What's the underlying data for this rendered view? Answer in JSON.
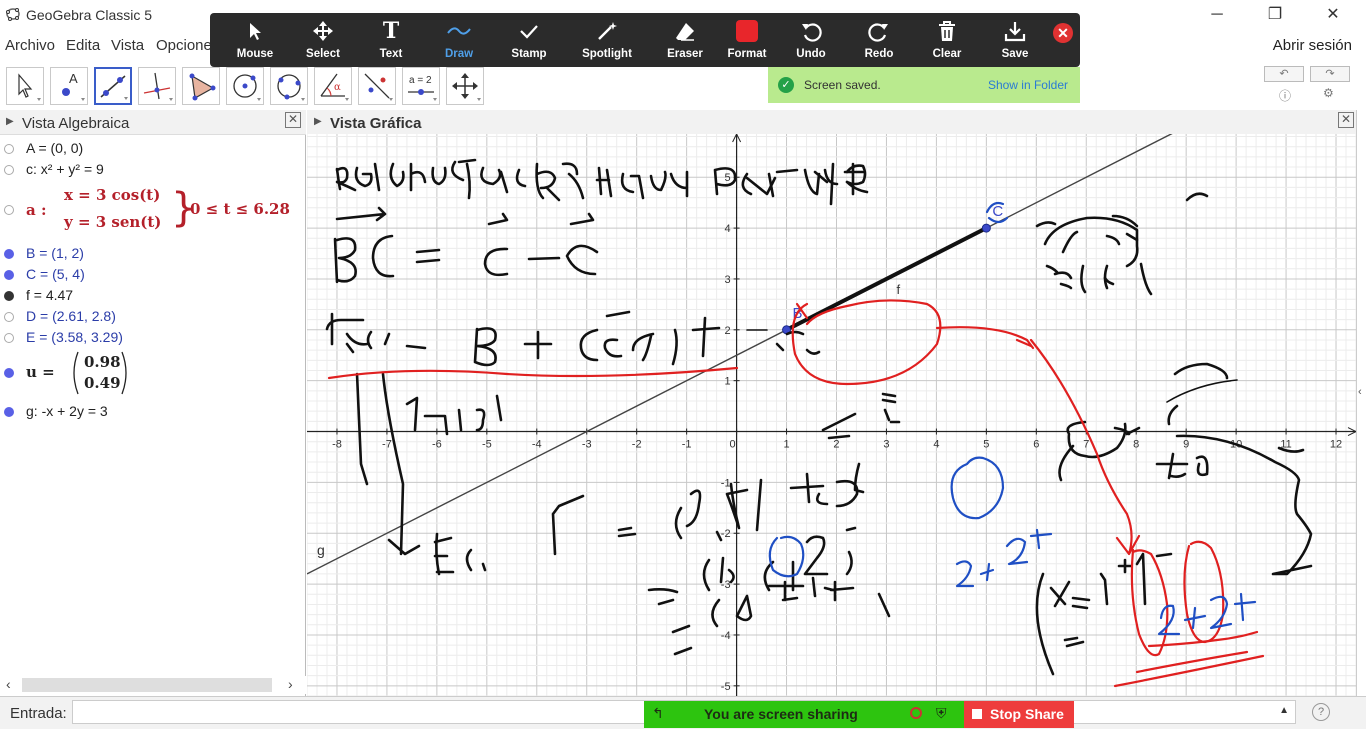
{
  "window": {
    "title": "GeoGebra Classic 5"
  },
  "menu": {
    "items": [
      "Archivo",
      "Edita",
      "Vista",
      "Opcione"
    ],
    "login": "Abrir sesión"
  },
  "overlay_toolbar": {
    "buttons": [
      {
        "label": "Mouse",
        "icon": "cursor-icon"
      },
      {
        "label": "Select",
        "icon": "move-icon"
      },
      {
        "label": "Text",
        "icon": "text-icon"
      },
      {
        "label": "Draw",
        "icon": "draw-wave-icon",
        "active": true
      },
      {
        "label": "Stamp",
        "icon": "checkmark-icon"
      },
      {
        "label": "Spotlight",
        "icon": "wand-icon"
      },
      {
        "label": "Eraser",
        "icon": "eraser-icon"
      },
      {
        "label": "Format",
        "icon": "color-swatch-icon"
      },
      {
        "label": "Undo",
        "icon": "undo-icon"
      },
      {
        "label": "Redo",
        "icon": "redo-icon"
      },
      {
        "label": "Clear",
        "icon": "trash-icon"
      },
      {
        "label": "Save",
        "icon": "save-icon"
      }
    ],
    "active_color": "#4f9fe8",
    "format_color": "#e8262b"
  },
  "toast": {
    "text": "Screen saved.",
    "link": "Show in Folder"
  },
  "tools": [
    "move-tool-icon",
    "point-tool-icon",
    "line-tool-icon",
    "perpendicular-tool-icon",
    "polygon-tool-icon",
    "circle-center-tool-icon",
    "circle-three-points-tool-icon",
    "angle-tool-icon",
    "reflect-tool-icon",
    "slider-tool-icon",
    "move-graphics-tool-icon"
  ],
  "slider_tool_text": "a = 2",
  "algebra": {
    "title": "Vista Algebraica",
    "rows": [
      {
        "text": "A = (0, 0)",
        "dot": "hollow",
        "color": "#222222"
      },
      {
        "text": "c: x² + y² = 9",
        "dot": "hollow",
        "color": "#222222"
      },
      {
        "text": "D = (2.61, 2.8)",
        "dot": "hollow",
        "color": "#2b3da8"
      },
      {
        "text": "E = (3.58, 3.29)",
        "dot": "hollow",
        "color": "#2b3da8"
      },
      {
        "text": "B = (1, 2)",
        "dot": "filled",
        "color": "#2b3da8"
      },
      {
        "text": "C = (5, 4)",
        "dot": "filled",
        "color": "#2b3da8"
      },
      {
        "text": "f = 4.47",
        "dot": "black",
        "color": "#222222"
      },
      {
        "text": "g: -x + 2y = 3",
        "dot": "filled",
        "color": "#222222"
      }
    ],
    "curve_a": {
      "name": "a :",
      "x_eq": "x = 3  cos(t)",
      "y_eq": "y = 3  sen(t)",
      "range": "0 ≤ t ≤ 6.28",
      "color": "#b4202a"
    },
    "vector_u": {
      "name": "u =",
      "v1": "0.98",
      "v2": "0.49"
    }
  },
  "graphics": {
    "title": "Vista Gráfica",
    "x_ticks": [
      -8,
      -7,
      -6,
      -5,
      -4,
      -3,
      -2,
      -1,
      0,
      1,
      2,
      3,
      4,
      5,
      6,
      7,
      8,
      9,
      10,
      11,
      12
    ],
    "y_ticks": [
      5,
      4,
      3,
      2,
      1,
      -1,
      -2,
      -3,
      -4,
      -5
    ],
    "x_range": [
      -8.6,
      12.4
    ],
    "y_range": [
      -5.2,
      5.85
    ],
    "points": [
      {
        "name": "B",
        "x": 1,
        "y": 2
      },
      {
        "name": "C",
        "x": 5,
        "y": 4
      }
    ],
    "line_g": {
      "name": "g",
      "equation": "-x + 2y = 3"
    },
    "segment_f": {
      "name": "f"
    },
    "handwriting": {
      "title": "Recta que pasa por B y C",
      "bc": "BC = C - B",
      "param": "r(t) = B + (C - B)t",
      "t_real": "t∈R",
      "coords_c": "(5,4)",
      "coords_b": "(1,2)",
      "vec": "(4,2).t",
      "ec": "Ec.",
      "eq1": "r = (1,2) + (4,2)t",
      "eq2": "= (1,2) + (4t, 2t)",
      "eq3": "(1 + 4t, 2 + 2t)",
      "sys_x": "x = 1 + 4t",
      "sys_y": "y = 2 + 2t",
      "t_real2": "t∈R"
    }
  },
  "input": {
    "label": "Entrada:",
    "value": ""
  },
  "sharing": {
    "text": "You are screen sharing",
    "stop": "Stop Share"
  }
}
